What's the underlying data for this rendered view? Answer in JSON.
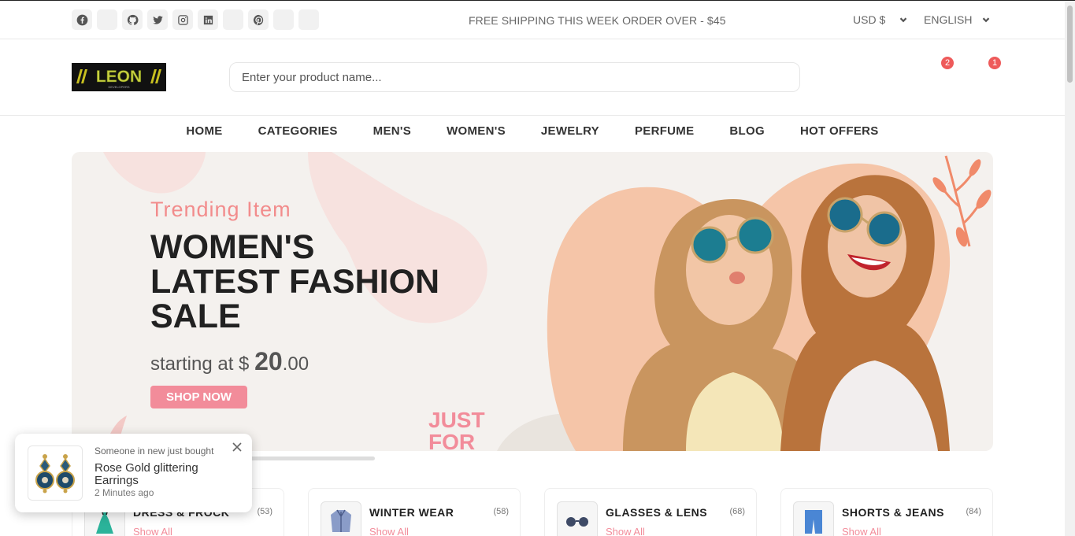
{
  "topbar": {
    "socials": [
      "facebook-icon",
      "blank-icon",
      "github-icon",
      "twitter-icon",
      "instagram-icon",
      "linkedin-icon",
      "blank-icon",
      "pinterest-icon",
      "blank-icon",
      "blank-icon"
    ],
    "shipping_text": "FREE SHIPPING THIS WEEK ORDER OVER - $45",
    "currency": "USD $",
    "language": "ENGLISH"
  },
  "header": {
    "logo_text": "LEON",
    "logo_sub": "DEVELOPERS",
    "search_placeholder": "Enter your product name...",
    "wishlist_count": "2",
    "cart_count": "1"
  },
  "nav": {
    "items": [
      "HOME",
      "CATEGORIES",
      "MEN'S",
      "WOMEN'S",
      "JEWELRY",
      "PERFUME",
      "BLOG",
      "HOT OFFERS"
    ]
  },
  "hero": {
    "subtitle": "Trending Item",
    "title": "WOMEN'S LATEST FASHION SALE",
    "price_prefix": "starting at $",
    "price_main": "20",
    "price_cents": ".00",
    "button": "SHOP NOW",
    "sticker_text_1": "JUST",
    "sticker_text_2": "FOR"
  },
  "categories": [
    {
      "title": "DRESS & FROCK",
      "count": "(53)",
      "link": "Show All"
    },
    {
      "title": "WINTER WEAR",
      "count": "(58)",
      "link": "Show All"
    },
    {
      "title": "GLASSES & LENS",
      "count": "(68)",
      "link": "Show All"
    },
    {
      "title": "SHORTS & JEANS",
      "count": "(84)",
      "link": "Show All"
    }
  ],
  "toast": {
    "message": "Someone in new just bought",
    "product": "Rose Gold glittering Earrings",
    "time": "2 Minutes ago"
  },
  "colors": {
    "accent": "#f28c9a",
    "badge": "#ee5a5a",
    "dark": "#212121"
  }
}
